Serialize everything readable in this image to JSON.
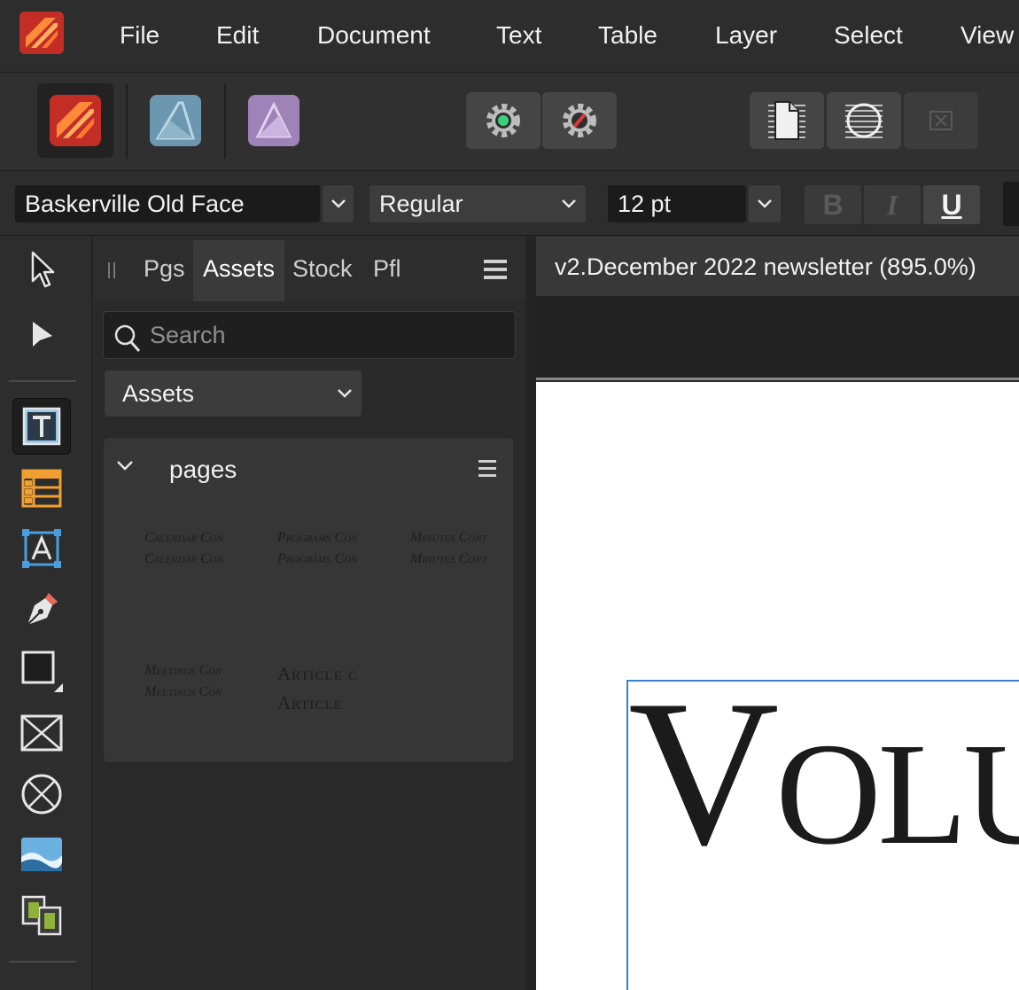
{
  "menubar": {
    "items": [
      "File",
      "Edit",
      "Document",
      "Text",
      "Table",
      "Layer",
      "Select",
      "View"
    ]
  },
  "toolbar": {
    "personas": [
      "publisher-persona",
      "designer-persona",
      "photo-persona"
    ],
    "buttons": [
      "preflight-gear-icon",
      "preflight-off-icon",
      "page-icon",
      "master-icon",
      "delete-icon"
    ]
  },
  "context": {
    "font_family": "Baskerville Old Face",
    "font_style": "Regular",
    "font_size": "12 pt",
    "bold_label": "B",
    "italic_label": "I",
    "underline_label": "U"
  },
  "panel": {
    "tabs": [
      "Pgs",
      "Assets",
      "Stock",
      "Pfl"
    ],
    "active_tab": "Assets",
    "search_placeholder": "Search",
    "category": "Assets",
    "group_title": "pages",
    "assets": [
      {
        "line1": "Calendar Con",
        "line2": "Calendar Con"
      },
      {
        "line1": "Programs Con",
        "line2": "Programs Con"
      },
      {
        "line1": "Minutes Cont",
        "line2": "Minutes Cont"
      },
      {
        "line1": "Meetings Con",
        "line2": "Meetings Con"
      },
      {
        "line1": "Article c",
        "line2": "Article"
      }
    ]
  },
  "document": {
    "tab_title": "v2.December 2022 newsletter (895.0%)",
    "headline": "Volu"
  },
  "colors": {
    "accent": "#3b7fd0",
    "publisher_orange": "#ff6a2a",
    "designer_blue": "#6b97b0",
    "photo_purple": "#b99ad0"
  }
}
